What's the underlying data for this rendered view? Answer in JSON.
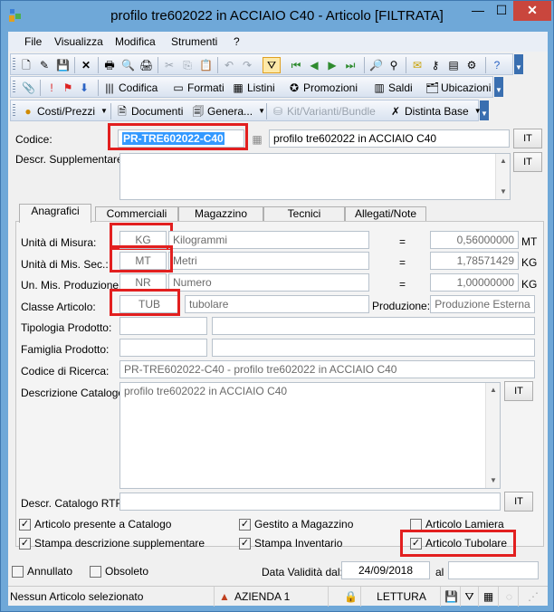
{
  "window": {
    "title": "profilo tre602022 in ACCIAIO C40 - Articolo [FILTRATA]",
    "minimize_glyph": "—",
    "maximize_glyph": "☐",
    "close_glyph": "✕"
  },
  "menu": [
    "File",
    "Visualizza",
    "Modifica",
    "Strumenti",
    "?"
  ],
  "toolbar2": {
    "codifica": "Codifica",
    "formati": "Formati",
    "listini": "Listini",
    "promozioni": "Promozioni",
    "saldi": "Saldi",
    "ubicazioni": "Ubicazioni"
  },
  "toolbar3": {
    "costi_prezzi": "Costi/Prezzi",
    "documenti": "Documenti",
    "generazione": "Genera...",
    "kit": "Kit/Varianti/Bundle",
    "distinta": "Distinta Base"
  },
  "header": {
    "codice_label": "Codice:",
    "codice_value": "PR-TRE602022-C40",
    "descrizione_value": "profilo tre602022 in ACCIAIO C40",
    "descr_supp_label": "Descr. Supplementare:",
    "descr_supp_value": "",
    "it_label": "IT"
  },
  "tabs": [
    "Anagrafici",
    "Commerciali",
    "Magazzino",
    "Tecnici",
    "Allegati/Note"
  ],
  "anagrafici": {
    "um_label": "Unità di Misura:",
    "um_code": "KG",
    "um_desc": "Kilogrammi",
    "um_factor": "0,56000000",
    "um_unit": "MT",
    "ums_label": "Unità di Mis. Sec.:",
    "ums_code": "MT",
    "ums_desc": "Metri",
    "ums_factor": "1,78571429",
    "ums_unit": "KG",
    "ump_label": "Un. Mis. Produzione:",
    "ump_code": "NR",
    "ump_desc": "Numero",
    "ump_factor": "1,00000000",
    "ump_unit": "KG",
    "equals": "=",
    "classe_label": "Classe Articolo:",
    "classe_code": "TUB",
    "classe_desc": "tubolare",
    "produzione_label": "Produzione:",
    "produzione_value": "Produzione Esterna",
    "tipologia_label": "Tipologia Prodotto:",
    "famiglia_label": "Famiglia Prodotto:",
    "ricerca_label": "Codice di Ricerca:",
    "ricerca_value": "PR-TRE602022-C40 - profilo tre602022 in ACCIAIO C40",
    "catalogo_label": "Descrizione Catalogo:",
    "catalogo_value": "profilo tre602022 in ACCIAIO C40",
    "rtf_label": "Descr. Catalogo RTF:",
    "chk_presente": "Articolo presente a Catalogo",
    "chk_gestito": "Gestito a Magazzino",
    "chk_lamiera": "Articolo Lamiera",
    "chk_stampa_descr": "Stampa descrizione supplementare",
    "chk_stampa_inv": "Stampa Inventario",
    "chk_tubolare": "Articolo Tubolare"
  },
  "footer": {
    "annullato": "Annullato",
    "obsoleto": "Obsoleto",
    "validita_label": "Data Validità dal:",
    "validita_value": "24/09/2018",
    "al_label": "al",
    "al_value": ""
  },
  "status": {
    "message": "Nessun Articolo selezionato",
    "azienda": "AZIENDA 1",
    "mode": "LETTURA"
  },
  "colors": {
    "highlight_box": "#e21f1f",
    "selection": "#3399ff",
    "title_bar": "#6fa8d8"
  }
}
